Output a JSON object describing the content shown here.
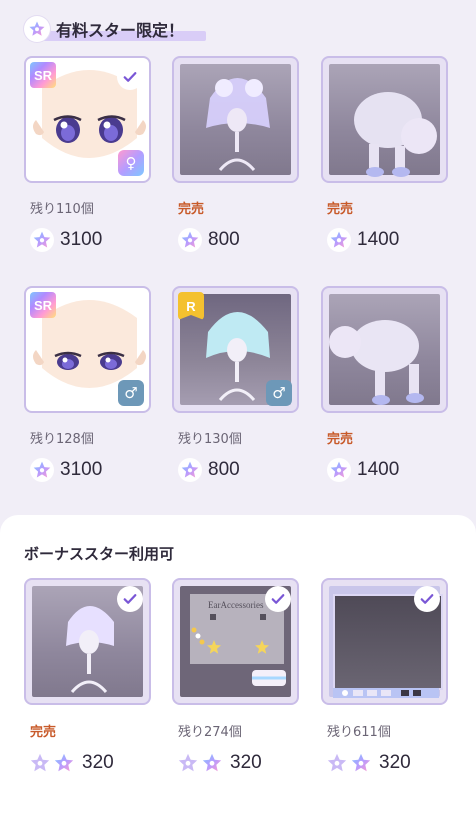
{
  "section1": {
    "title": "有料スター限定！"
  },
  "section2": {
    "title": "ボーナススター利用可"
  },
  "items": [
    {
      "stock": "残り110個",
      "price": "3100",
      "rarity": "SR",
      "gender_icon": "female-icon",
      "checked": true,
      "sold_out": false
    },
    {
      "stock": "完売",
      "price": "800",
      "checked": false,
      "sold_out": true
    },
    {
      "stock": "完売",
      "price": "1400",
      "checked": false,
      "sold_out": true
    },
    {
      "stock": "残り128個",
      "price": "3100",
      "rarity": "SR",
      "gender_icon": "male-icon",
      "checked": false,
      "sold_out": false
    },
    {
      "stock": "残り130個",
      "price": "800",
      "rarity": "R",
      "gender_icon": "male-icon",
      "checked": false,
      "sold_out": false
    },
    {
      "stock": "完売",
      "price": "1400",
      "checked": false,
      "sold_out": true
    },
    {
      "stock": "完売",
      "price": "320",
      "checked": true,
      "sold_out": true,
      "bonus": true
    },
    {
      "stock": "残り274個",
      "price": "320",
      "checked": true,
      "sold_out": false,
      "bonus": true,
      "card_label": "EarAccessories"
    },
    {
      "stock": "残り611個",
      "price": "320",
      "checked": true,
      "sold_out": false,
      "bonus": true
    }
  ],
  "icons": {
    "star_currency": "star-currency-icon",
    "bonus_star": "bonus-star-icon",
    "check": "check-icon"
  },
  "colors": {
    "accent": "#7a57d6",
    "sold_out": "#c85a2a",
    "card_border": "#c9bde8",
    "highlight": "#d9cdf7"
  }
}
